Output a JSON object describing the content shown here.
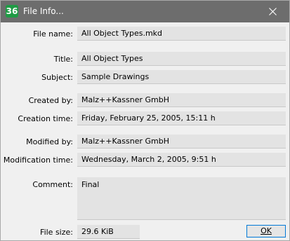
{
  "window": {
    "title": "File Info...",
    "icon": "app-logo-icon",
    "icon_text": "36"
  },
  "fields": {
    "file_name": {
      "label": "File name:",
      "value": "All Object Types.mkd"
    },
    "title": {
      "label": "Title:",
      "value": "All Object Types"
    },
    "subject": {
      "label": "Subject:",
      "value": "Sample Drawings"
    },
    "created_by": {
      "label": "Created by:",
      "value": "Malz++Kassner GmbH"
    },
    "creation_time": {
      "label": "Creation time:",
      "value": "Friday, February 25, 2005, 15:11 h"
    },
    "modified_by": {
      "label": "Modified by:",
      "value": "Malz++Kassner GmbH"
    },
    "modification_time": {
      "label": "Modification time:",
      "value": "Wednesday, March 2, 2005, 9:51 h"
    },
    "comment": {
      "label": "Comment:",
      "value": "Final"
    },
    "file_size": {
      "label": "File size:",
      "value": "29.6 KiB"
    }
  },
  "buttons": {
    "ok": "OK"
  },
  "colors": {
    "titlebar": "#6d6d6d",
    "icon_bg": "#1f9b45",
    "field_bg": "#e3e3e3",
    "button_border": "#0078d7"
  }
}
